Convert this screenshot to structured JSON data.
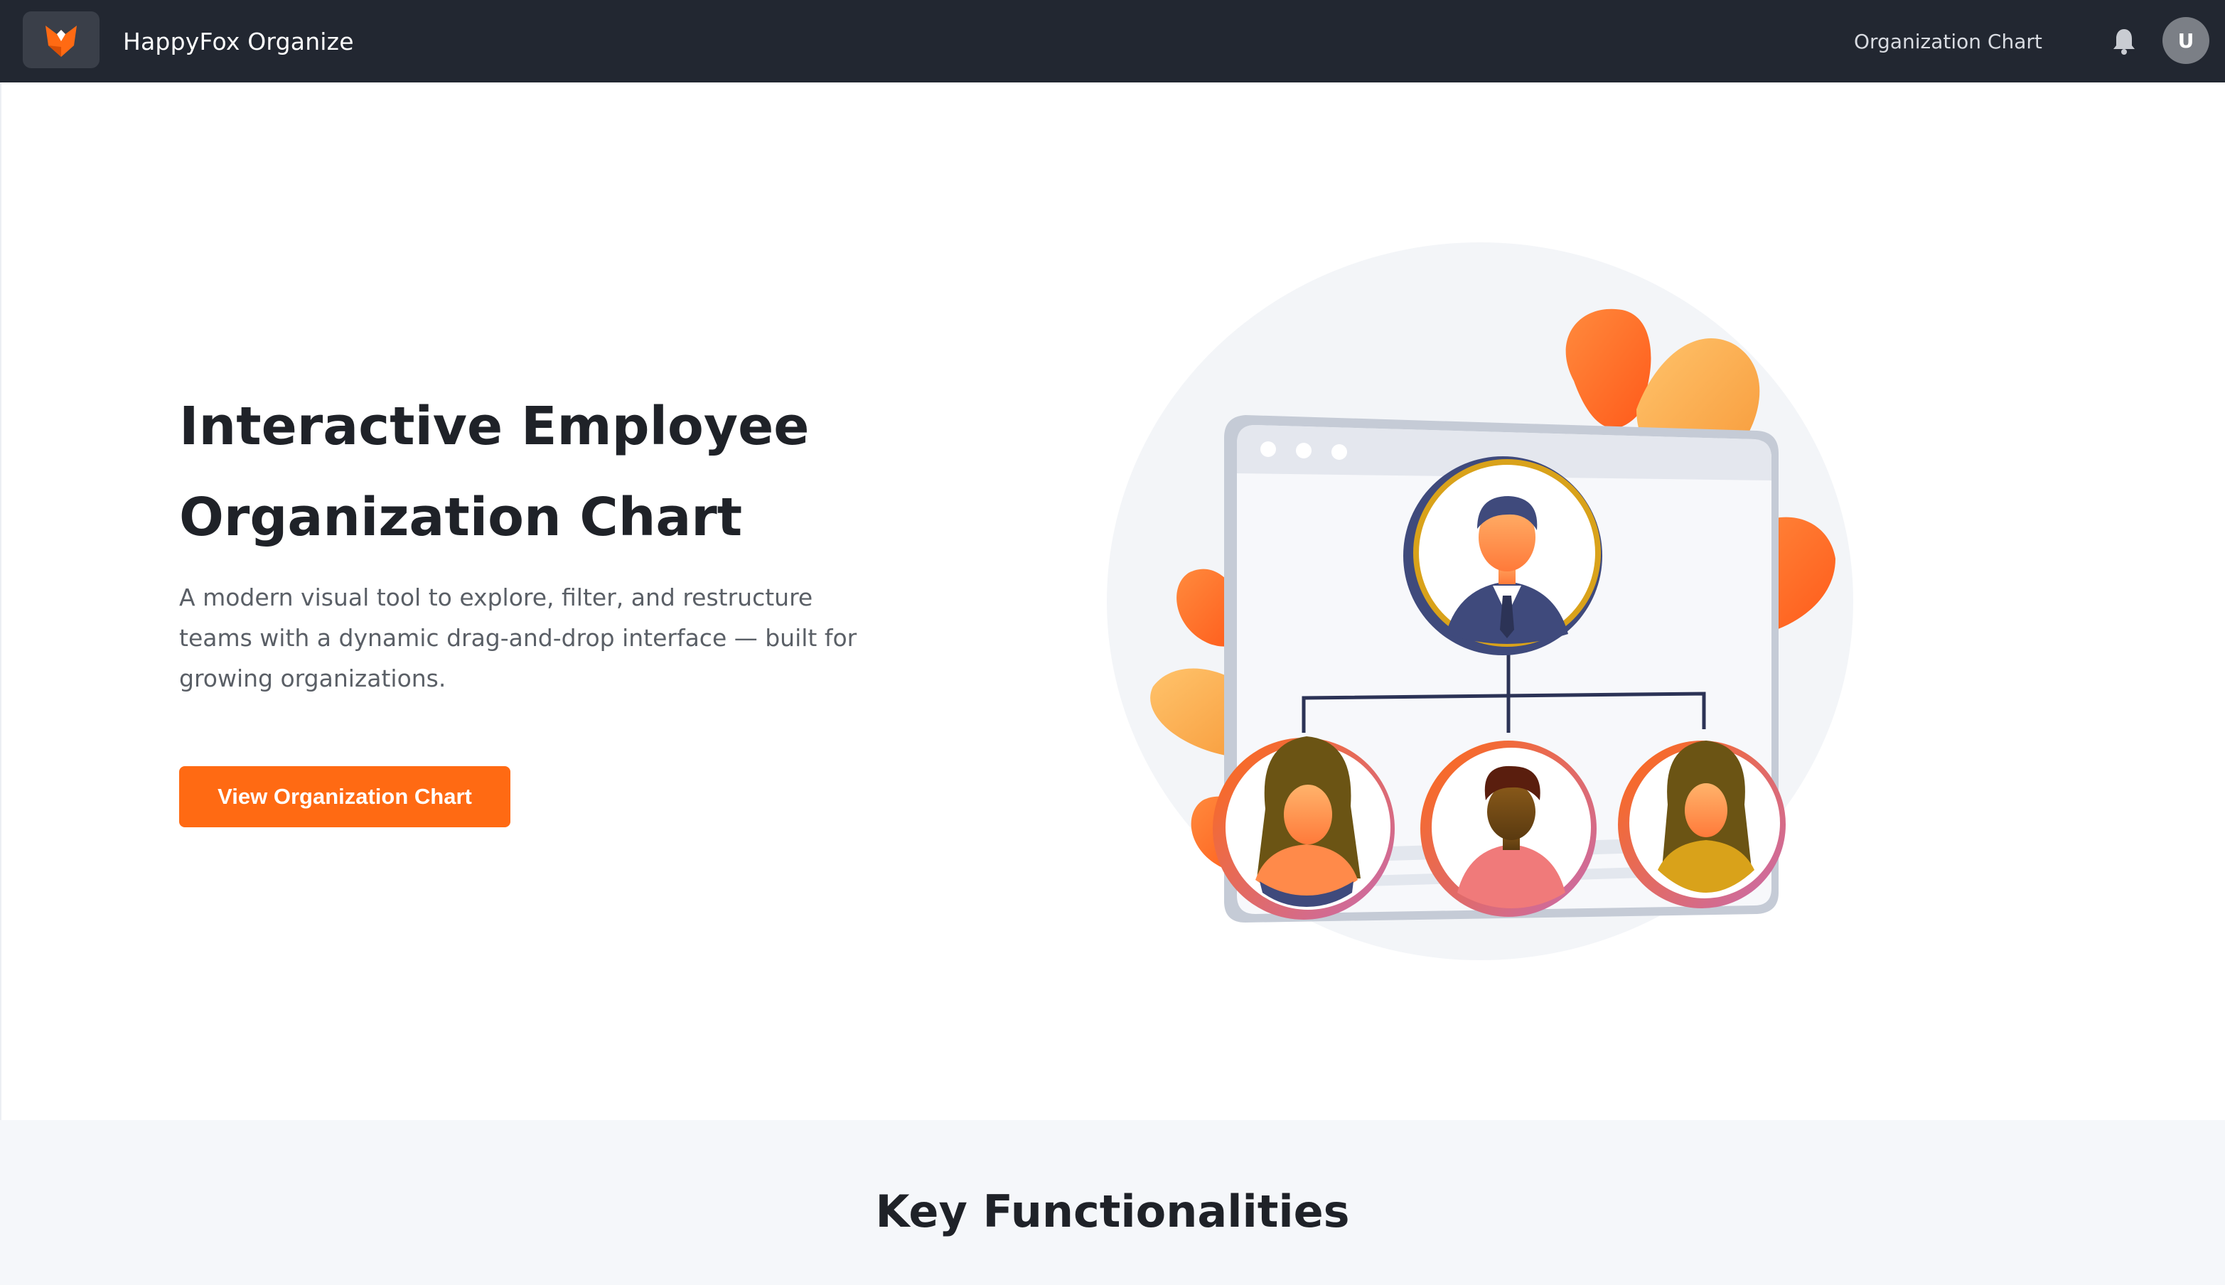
{
  "header": {
    "brand": "HappyFox Organize",
    "nav_link": "Organization Chart",
    "avatar_initial": "U"
  },
  "hero": {
    "title": "Interactive Employee Organization Chart",
    "subtitle": "A modern visual tool to explore, filter, and restructure teams with a dynamic drag-and-drop interface — built for growing organizations.",
    "cta_label": "View Organization Chart"
  },
  "features": {
    "title": "Key Functionalities"
  },
  "colors": {
    "topbar": "#222731",
    "accent": "#ff6a13",
    "features_bg": "#f5f7fa",
    "text_dark": "#1f2228",
    "text_muted": "#5a5f66"
  },
  "icons": [
    "fox-logo-icon",
    "bell-icon",
    "org-chart-illustration"
  ]
}
